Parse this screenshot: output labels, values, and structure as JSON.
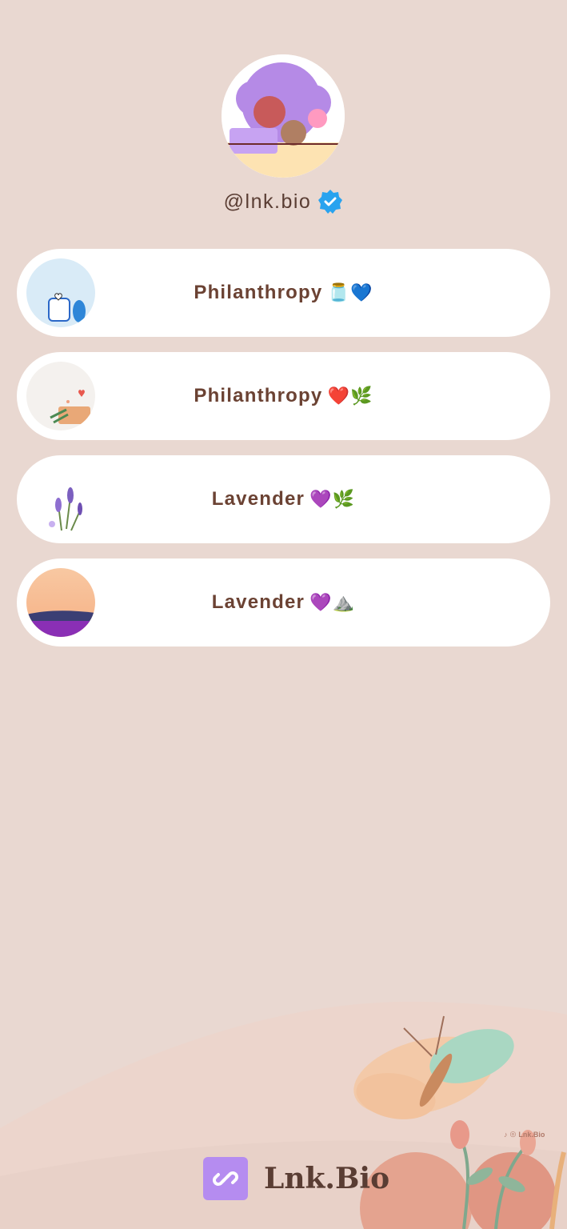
{
  "profile": {
    "handle": "@lnk.bio",
    "verified": true,
    "verified_color": "#29a3ef"
  },
  "links": [
    {
      "label": "Philanthropy",
      "emoji": "🫙💙",
      "thumb": "jar-hearts"
    },
    {
      "label": "Philanthropy",
      "emoji": "❤️🌿",
      "thumb": "crate-hearts"
    },
    {
      "label": "Lavender",
      "emoji": "💜🌿",
      "thumb": "lavender-sprig"
    },
    {
      "label": "Lavender",
      "emoji": "💜⛰️",
      "thumb": "lavender-field-sunset"
    }
  ],
  "footer": {
    "brand": "Lnk.Bio",
    "credit": "Lnk.Bio"
  },
  "colors": {
    "background": "#e9d8d1",
    "card": "#ffffff",
    "text": "#6b4233",
    "logo_accent": "#b58cf0"
  }
}
